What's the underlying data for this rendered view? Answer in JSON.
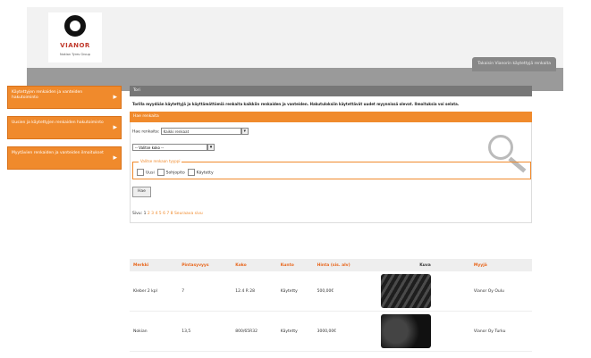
{
  "header": {
    "logo_text": "VIANOR",
    "logo_tagline": "Nokian Tyres Group",
    "top_tab": "Takaisin Vianorin käytettyjä renkaita"
  },
  "sidebar": {
    "items": [
      {
        "label": "Käytettyjen renkaiden ja vanteiden hakutoiminto"
      },
      {
        "label": "Uusien ja käytettyjen renkaiden hakutoiminto"
      },
      {
        "label": "Myytävien renkaiden ja vanteiden ilmoitukset"
      }
    ]
  },
  "main": {
    "section_title": "Tori",
    "intro": "Torilla myydään käytettyjä ja käyttämättömiä renkaita kaikkiin renkaiden ja vanteiden. Hakutuloksiin käytettävät uudet myynnissä olevat. Ilmoituksia voi selata.",
    "search_title": "Hae renkaita",
    "search": {
      "category_label": "Hae renkaita:",
      "category_value": "Kaikki renkaat",
      "size_value": "-- Valitse koko --",
      "filter_legend": "Valitse renkaan tyyppi",
      "checkboxes": [
        "Uusi",
        "Sohjopito",
        "Käytetty"
      ],
      "button_label": "Hae"
    },
    "pager": {
      "prefix": "Sivu:",
      "current": "1",
      "pages": "2 3 4 5 6 7 8",
      "suffix": "Seuraava sivu"
    }
  },
  "table": {
    "headers": [
      "Merkki",
      "Pintasyvyys",
      "Koko",
      "Kunto",
      "Hinta (sis. alv)",
      "Kuva",
      "Myyjä"
    ],
    "rows": [
      {
        "brand": "Kleber 2 kpl",
        "tread": "7",
        "size": "12.4 R 28",
        "condition": "Käytetty",
        "price": "500,00€",
        "seller": "Vianor Oy Oulu"
      },
      {
        "brand": "Nokian",
        "tread": "13,5",
        "size": "800/65R32",
        "condition": "Käytetty",
        "price": "3000,00€",
        "seller": "Vianor Oy Turku"
      }
    ]
  },
  "colors": {
    "accent": "#f08a2c",
    "nav_gray": "#9a9a9a",
    "title_gray": "#777777"
  }
}
